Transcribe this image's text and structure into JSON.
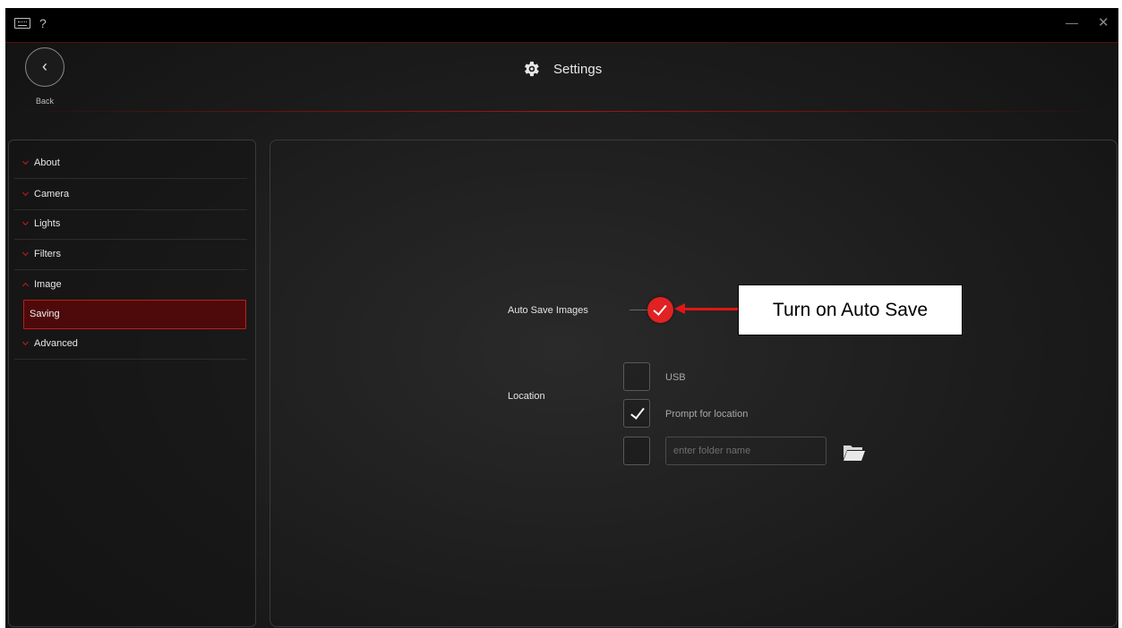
{
  "titlebar": {
    "keyboard_icon": "keyboard-icon",
    "help_label": "?",
    "minimize_label": "—",
    "close_label": "✕"
  },
  "header": {
    "back_glyph": "‹",
    "back_label": "Back",
    "title": "Settings",
    "title_icon": "gear-icon"
  },
  "sidebar": {
    "items": [
      {
        "label": "About"
      },
      {
        "label": "Camera"
      },
      {
        "label": "Lights"
      },
      {
        "label": "Filters"
      },
      {
        "label": "Image"
      },
      {
        "label": "Saving",
        "active": true
      },
      {
        "label": "Advanced"
      }
    ]
  },
  "saving": {
    "auto_save_label": "Auto Save Images",
    "auto_save_on": true,
    "location_label": "Location",
    "options": [
      {
        "label": "USB",
        "checked": false
      },
      {
        "label": "Prompt for location",
        "checked": true
      },
      {
        "label": "",
        "checked": false
      }
    ],
    "folder_placeholder": "enter folder name",
    "folder_value": ""
  },
  "annotation": {
    "callout_text": "Turn on Auto Save"
  },
  "colors": {
    "accent": "#e02222",
    "active_bg": "#4e0a0a",
    "background": "#1c1c1c"
  }
}
